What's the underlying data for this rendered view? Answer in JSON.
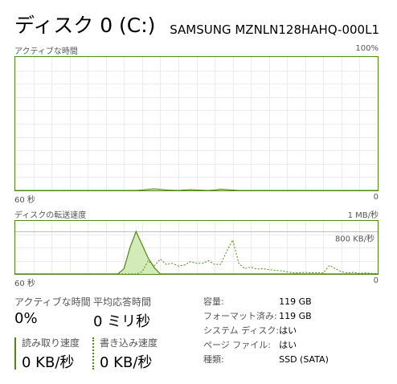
{
  "header": {
    "title": "ディスク 0 (C:)",
    "device": "SAMSUNG MZNLN128HAHQ-000L1"
  },
  "active_time_graph": {
    "label": "アクティブな時間",
    "max_label": "100%",
    "time_label": "60 秒",
    "min_label": "0"
  },
  "transfer_graph": {
    "label": "ディスクの転送速度",
    "max_label": "1 MB/秒",
    "ref_label": "800 KB/秒",
    "time_label": "60 秒",
    "min_label": "0"
  },
  "stats": {
    "active_time_label": "アクティブな時間",
    "active_time_value": "0%",
    "avg_response_label": "平均応答時間",
    "avg_response_value": "0 ミリ秒",
    "read_label": "読み取り速度",
    "read_value": "0 KB/秒",
    "write_label": "書き込み速度",
    "write_value": "0 KB/秒"
  },
  "properties": [
    {
      "key": "容量:",
      "value": "119 GB"
    },
    {
      "key": "フォーマット済み:",
      "value": "119 GB"
    },
    {
      "key": "システム ディスク:",
      "value": "はい"
    },
    {
      "key": "ページ ファイル:",
      "value": "はい"
    },
    {
      "key": "種類:",
      "value": "SSD (SATA)"
    }
  ],
  "colors": {
    "accent": "#4f8a10",
    "fill": "#d3ebb8",
    "grid": "#ececec"
  },
  "chart_data": [
    {
      "type": "area",
      "x_range": [
        60,
        0
      ],
      "ylim": [
        0,
        100
      ],
      "series": [
        {
          "x": [
            60,
            40,
            39,
            38,
            37,
            36,
            35,
            33,
            32,
            31,
            30,
            28,
            27,
            26,
            25,
            24,
            23,
            22,
            21,
            20,
            0
          ],
          "values": [
            0,
            0,
            0.3,
            0.8,
            1.2,
            0.8,
            0.3,
            0,
            0.3,
            0.6,
            0.3,
            0,
            0.3,
            1.0,
            0.6,
            0.3,
            0,
            0,
            0,
            0,
            0
          ]
        }
      ]
    },
    {
      "type": "area",
      "x_range": [
        60,
        0
      ],
      "ylim": [
        0,
        1000
      ],
      "series": [
        {
          "style": "solid",
          "x": [
            60,
            43,
            42,
            41,
            40,
            39,
            38,
            37,
            36,
            0
          ],
          "values": [
            0,
            0,
            100,
            500,
            800,
            550,
            300,
            120,
            0,
            0
          ]
        },
        {
          "style": "dotted",
          "x": [
            60,
            40,
            39,
            38,
            37,
            36,
            35,
            34,
            33,
            32,
            31,
            30,
            29,
            28,
            27,
            26,
            25,
            24,
            23,
            22,
            21,
            20,
            19,
            18,
            17,
            16,
            15,
            14,
            13,
            12,
            11,
            10,
            9,
            8,
            7,
            6,
            5,
            4,
            3,
            2,
            1,
            0
          ],
          "values": [
            0,
            0,
            40,
            250,
            150,
            280,
            180,
            200,
            150,
            170,
            230,
            200,
            200,
            250,
            180,
            180,
            430,
            640,
            200,
            100,
            130,
            90,
            100,
            80,
            70,
            60,
            40,
            20,
            20,
            30,
            20,
            25,
            20,
            160,
            100,
            40,
            20,
            30,
            10,
            20,
            10,
            10
          ]
        }
      ]
    }
  ]
}
